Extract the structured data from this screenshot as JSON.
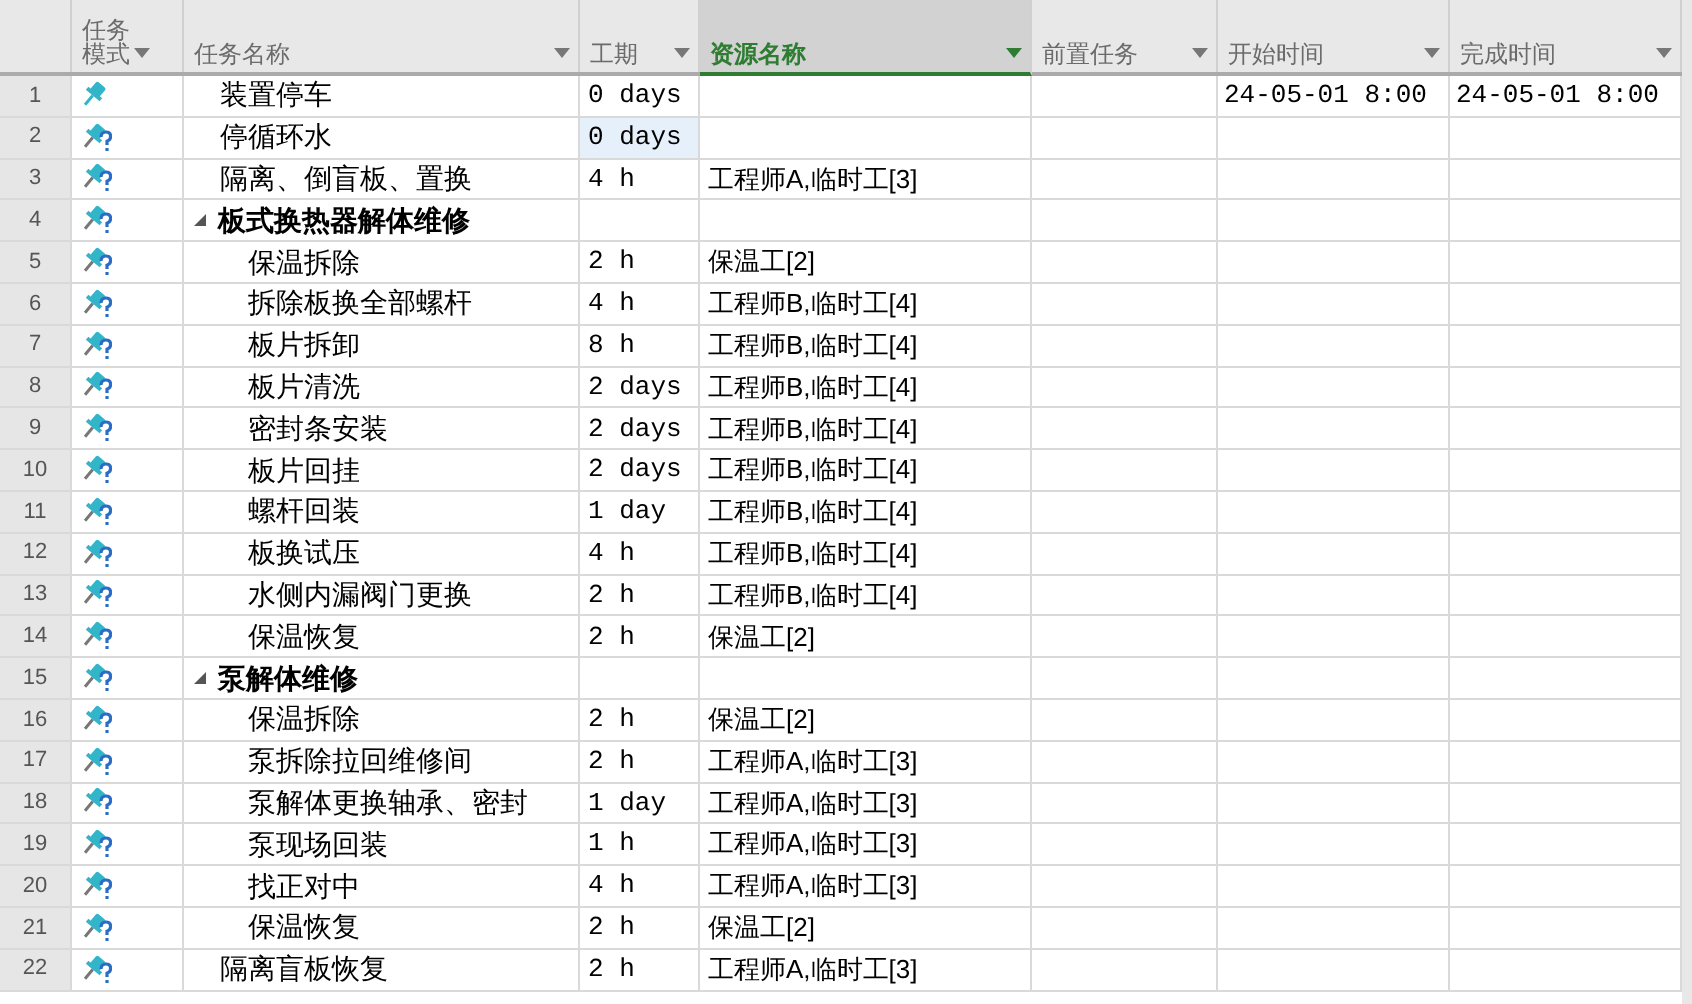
{
  "columns": [
    {
      "label": "任务模式",
      "selected": false
    },
    {
      "label": "任务名称",
      "selected": false
    },
    {
      "label": "工期",
      "selected": false
    },
    {
      "label": "资源名称",
      "selected": true
    },
    {
      "label": "前置任务",
      "selected": false
    },
    {
      "label": "开始时间",
      "selected": false
    },
    {
      "label": "完成时间",
      "selected": false
    }
  ],
  "tasks": [
    {
      "id": "1",
      "estimated": false,
      "name": "装置停车",
      "duration": "0 days",
      "duration_selected": false,
      "start": "24-05-01 8:00",
      "finish": "24-05-01 8:00"
    },
    {
      "id": "2",
      "estimated": true,
      "name": "停循环水",
      "duration": "0 days",
      "duration_selected": true
    },
    {
      "id": "3",
      "estimated": true,
      "name": "隔离、倒盲板、置换",
      "duration": "4 h",
      "duration_selected": false,
      "resources": "工程师A,临时工[3]"
    },
    {
      "id": "4",
      "estimated": true,
      "name": "板式换热器解体维修",
      "duration_selected": false,
      "expanded": true,
      "children": [
        {
          "id": "5",
          "estimated": true,
          "name": "保温拆除",
          "duration": "2 h",
          "duration_selected": false,
          "resources": "保温工[2]"
        },
        {
          "id": "6",
          "estimated": true,
          "name": "拆除板换全部螺杆",
          "duration": "4 h",
          "duration_selected": false,
          "resources": "工程师B,临时工[4]"
        },
        {
          "id": "7",
          "estimated": true,
          "name": "板片拆卸",
          "duration": "8 h",
          "duration_selected": false,
          "resources": "工程师B,临时工[4]"
        },
        {
          "id": "8",
          "estimated": true,
          "name": "板片清洗",
          "duration": "2 days",
          "duration_selected": false,
          "resources": "工程师B,临时工[4]"
        },
        {
          "id": "9",
          "estimated": true,
          "name": "密封条安装",
          "duration": "2 days",
          "duration_selected": false,
          "resources": "工程师B,临时工[4]"
        },
        {
          "id": "10",
          "estimated": true,
          "name": "板片回挂",
          "duration": "2 days",
          "duration_selected": false,
          "resources": "工程师B,临时工[4]"
        },
        {
          "id": "11",
          "estimated": true,
          "name": "螺杆回装",
          "duration": "1 day",
          "duration_selected": false,
          "resources": "工程师B,临时工[4]"
        },
        {
          "id": "12",
          "estimated": true,
          "name": "板换试压",
          "duration": "4 h",
          "duration_selected": false,
          "resources": "工程师B,临时工[4]"
        },
        {
          "id": "13",
          "estimated": true,
          "name": "水侧内漏阀门更换",
          "duration": "2 h",
          "duration_selected": false,
          "resources": "工程师B,临时工[4]"
        },
        {
          "id": "14",
          "estimated": true,
          "name": "保温恢复",
          "duration": "2 h",
          "duration_selected": false,
          "resources": "保温工[2]"
        }
      ]
    },
    {
      "id": "15",
      "estimated": true,
      "name": "泵解体维修",
      "duration_selected": false,
      "expanded": true,
      "children": [
        {
          "id": "16",
          "estimated": true,
          "name": "保温拆除",
          "duration": "2 h",
          "duration_selected": false,
          "resources": "保温工[2]"
        },
        {
          "id": "17",
          "estimated": true,
          "name": "泵拆除拉回维修间",
          "duration": "2 h",
          "duration_selected": false,
          "resources": "工程师A,临时工[3]"
        },
        {
          "id": "18",
          "estimated": true,
          "name": "泵解体更换轴承、密封",
          "duration": "1 day",
          "duration_selected": false,
          "resources": "工程师A,临时工[3]"
        },
        {
          "id": "19",
          "estimated": true,
          "name": "泵现场回装",
          "duration": "1 h",
          "duration_selected": false,
          "resources": "工程师A,临时工[3]"
        },
        {
          "id": "20",
          "estimated": true,
          "name": "找正对中",
          "duration": "4 h",
          "duration_selected": false,
          "resources": "工程师A,临时工[3]"
        },
        {
          "id": "21",
          "estimated": true,
          "name": "保温恢复",
          "duration": "2 h",
          "duration_selected": false,
          "resources": "保温工[2]"
        }
      ]
    },
    {
      "id": "22",
      "estimated": true,
      "name": "隔离盲板恢复",
      "duration": "2 h",
      "duration_selected": false,
      "resources": "工程师A,临时工[3]"
    }
  ]
}
